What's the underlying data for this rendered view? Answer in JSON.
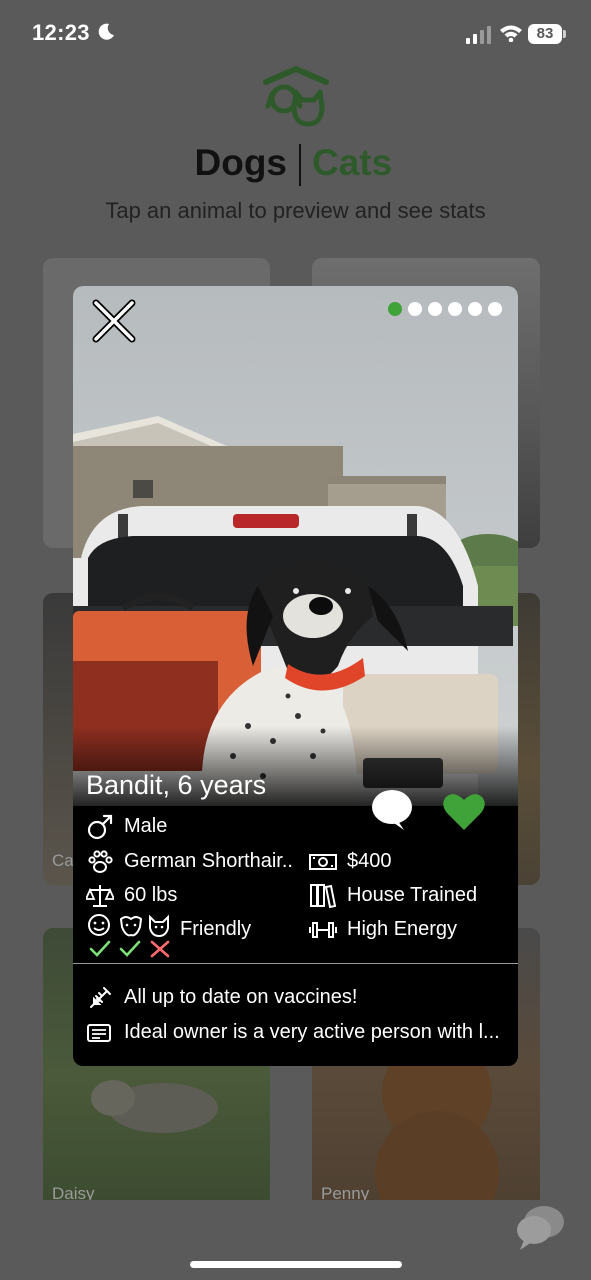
{
  "status_bar": {
    "time": "12:23",
    "battery": "83"
  },
  "header": {
    "tab_dogs": "Dogs",
    "tab_cats": "Cats",
    "active_tab": "Cats",
    "subtitle": "Tap an animal to preview and see stats"
  },
  "grid": {
    "labels": [
      "Ca",
      "Daisy",
      "Penny"
    ]
  },
  "modal": {
    "photo_count": 6,
    "active_photo": 1,
    "name_age": "Bandit, 6 years",
    "stats": {
      "sex": "Male",
      "breed": "German Shorthair..",
      "price": "$400",
      "weight": "60 lbs",
      "training": "House Trained",
      "temperament": "Friendly",
      "energy": "High Energy"
    },
    "compatibility": {
      "kids": true,
      "dogs": true,
      "cats": false
    },
    "notes": {
      "vaccines": "All up to date on vaccines!",
      "owner": "Ideal owner is a very active person with l..."
    }
  },
  "colors": {
    "accent_green": "#3fa33a",
    "brand_dark_green": "#2e5a2b",
    "check_green": "#7fe07a",
    "cross_red": "#ff6b6b",
    "overlay_gray": "#5a5a5a"
  }
}
